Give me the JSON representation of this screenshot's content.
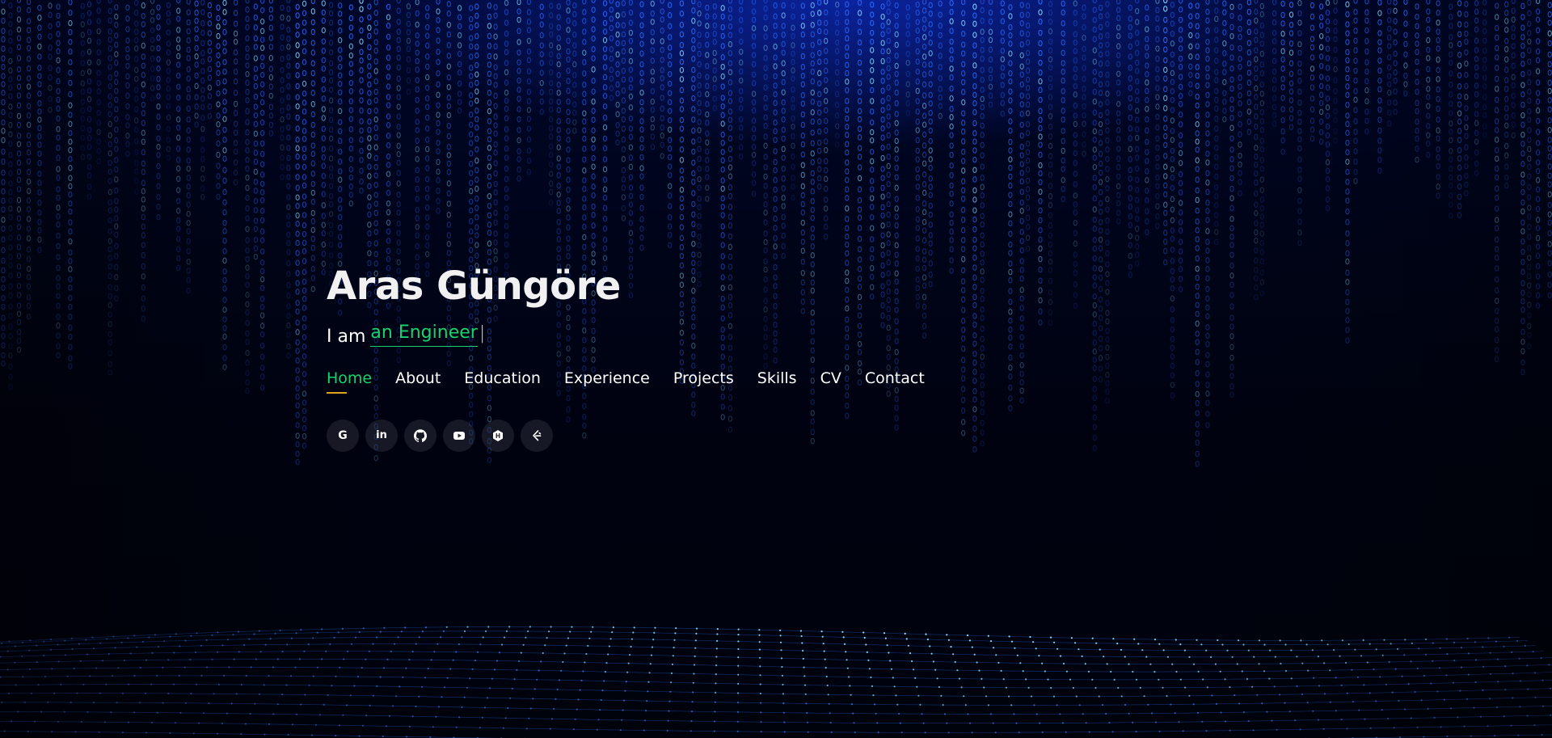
{
  "hero": {
    "name": "Aras Güngöre",
    "tagline_prefix": "I am",
    "tagline_role": "an Engineer",
    "tagline_cursor": "|"
  },
  "nav": {
    "items": [
      {
        "label": "Home",
        "active": true
      },
      {
        "label": "About",
        "active": false
      },
      {
        "label": "Education",
        "active": false
      },
      {
        "label": "Experience",
        "active": false
      },
      {
        "label": "Projects",
        "active": false
      },
      {
        "label": "Skills",
        "active": false
      },
      {
        "label": "CV",
        "active": false
      },
      {
        "label": "Contact",
        "active": false
      }
    ]
  },
  "social": {
    "links": [
      {
        "icon": "google-icon",
        "glyph": "G"
      },
      {
        "icon": "linkedin-icon",
        "glyph": "in"
      },
      {
        "icon": "github-icon"
      },
      {
        "icon": "youtube-icon"
      },
      {
        "icon": "hackerrank-icon"
      },
      {
        "icon": "leetcode-icon"
      }
    ]
  },
  "colors": {
    "accent": "#18d26e",
    "underline": "#e0a41c",
    "text": "#ffffff",
    "rain": "#2a6bff",
    "rain_bright": "#7fd4ff",
    "background": "#000210"
  }
}
